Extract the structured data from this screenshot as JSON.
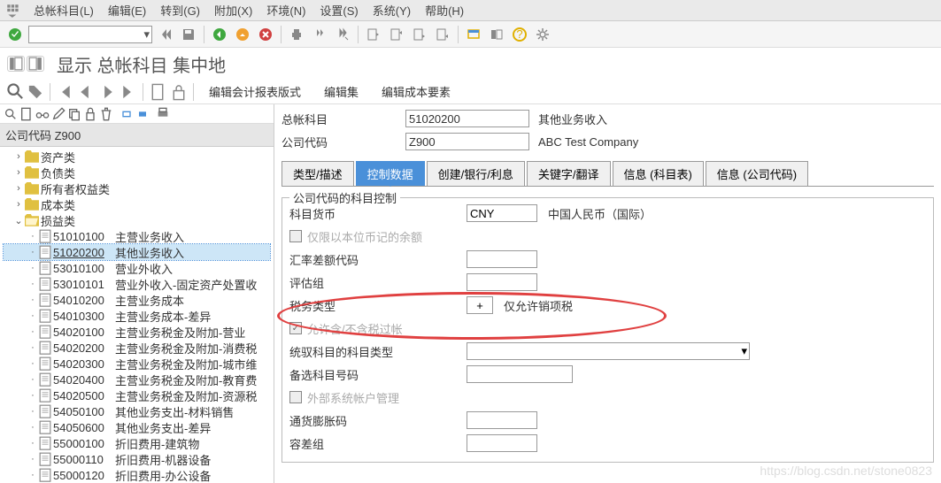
{
  "menubar": {
    "items": [
      {
        "label": "总帐科目(L)"
      },
      {
        "label": "编辑(E)"
      },
      {
        "label": "转到(G)"
      },
      {
        "label": "附加(X)"
      },
      {
        "label": "环境(N)"
      },
      {
        "label": "设置(S)"
      },
      {
        "label": "系统(Y)"
      },
      {
        "label": "帮助(H)"
      }
    ]
  },
  "page_title": "显示 总帐科目 集中地",
  "toolbar2": {
    "link1": "编辑会计报表版式",
    "link2": "编辑集",
    "link3": "编辑成本要素"
  },
  "sidebar": {
    "header": "公司代码 Z900",
    "categories": [
      {
        "label": "资产类"
      },
      {
        "label": "负债类"
      },
      {
        "label": "所有者权益类"
      },
      {
        "label": "成本类"
      },
      {
        "label": "损益类"
      }
    ],
    "items": [
      {
        "code": "51010100",
        "label": "主营业务收入"
      },
      {
        "code": "51020200",
        "label": "其他业务收入"
      },
      {
        "code": "53010100",
        "label": "营业外收入"
      },
      {
        "code": "53010101",
        "label": "营业外收入-固定资产处置收"
      },
      {
        "code": "54010200",
        "label": "主营业务成本"
      },
      {
        "code": "54010300",
        "label": "主营业务成本-差异"
      },
      {
        "code": "54020100",
        "label": "主营业务税金及附加-营业"
      },
      {
        "code": "54020200",
        "label": "主营业务税金及附加-消费税"
      },
      {
        "code": "54020300",
        "label": "主营业务税金及附加-城市维"
      },
      {
        "code": "54020400",
        "label": "主营业务税金及附加-教育费"
      },
      {
        "code": "54020500",
        "label": "主营业务税金及附加-资源税"
      },
      {
        "code": "54050100",
        "label": "其他业务支出-材料销售"
      },
      {
        "code": "54050600",
        "label": "其他业务支出-差异"
      },
      {
        "code": "55000100",
        "label": "折旧费用-建筑物"
      },
      {
        "code": "55000110",
        "label": "折旧费用-机器设备"
      },
      {
        "code": "55000120",
        "label": "折旧费用-办公设备"
      }
    ]
  },
  "header": {
    "account_label": "总帐科目",
    "account_value": "51020200",
    "account_desc": "其他业务收入",
    "company_label": "公司代码",
    "company_value": "Z900",
    "company_desc": "ABC Test Company"
  },
  "tabs": [
    "类型/描述",
    "控制数据",
    "创建/银行/利息",
    "关键字/翻译",
    "信息 (科目表)",
    "信息 (公司代码)"
  ],
  "form": {
    "group_title": "公司代码的科目控制",
    "currency_label": "科目货币",
    "currency_value": "CNY",
    "currency_desc": "中国人民币（国际）",
    "local_only_label": "仅限以本位币记的余额",
    "exrate_label": "汇率差额代码",
    "valgroup_label": "评估组",
    "taxtype_label": "税务类型",
    "taxtype_value": "+",
    "taxtype_desc": "仅允许销项税",
    "allow_notax_label": "允许含/不含税过帐",
    "recon_label": "统驭科目的科目类型",
    "alt_label": "备选科目号码",
    "ext_label": "外部系统帐户管理",
    "infl_label": "通货膨胀码",
    "tol_label": "容差组"
  },
  "watermark": "https://blog.csdn.net/stone0823"
}
